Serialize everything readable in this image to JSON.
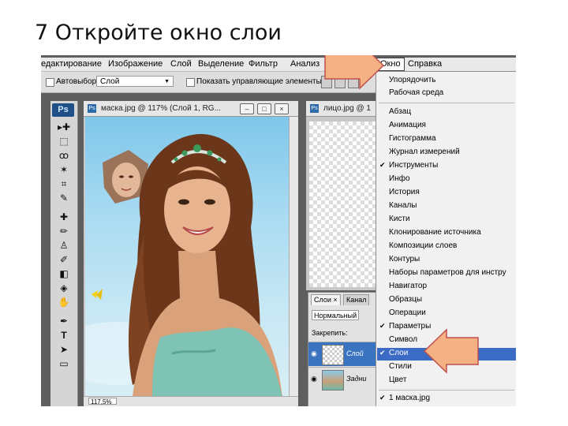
{
  "slide": {
    "title": "7 Откройте окно слои"
  },
  "menubar": {
    "items": [
      "едактирование",
      "Изображение",
      "Слой",
      "Выделение",
      "Фильтр",
      "Анализ"
    ],
    "active": "Окно",
    "last": "Справка"
  },
  "options": {
    "auto_select": "Автовыбор:",
    "layer_select": "Слой",
    "show_controls": "Показать управляющие элементы"
  },
  "toolbox": {
    "logo": "Ps",
    "tools": [
      "move-tool",
      "marquee-tool",
      "lasso-tool",
      "magic-wand-tool",
      "crop-tool",
      "eyedropper-tool",
      "spot-heal-tool",
      "brush-tool",
      "stamp-tool",
      "history-brush-tool",
      "eraser-tool",
      "paint-bucket-tool",
      "dodge-tool",
      "pen-tool",
      "type-tool",
      "path-select-tool",
      "shape-tool"
    ],
    "glyphs": [
      "▸✚",
      "⬚",
      "ꝏ",
      "✶",
      "⌗",
      "✎",
      "✚",
      "✏",
      "♙",
      "✐",
      "◧",
      "◈",
      "✋",
      "✒",
      "T",
      "➤",
      "▭"
    ]
  },
  "doc1": {
    "title": "маска.jpg @ 117% (Слой 1, RG...",
    "icon": "Ps",
    "zoom": "117,5%"
  },
  "doc2": {
    "title": "лицо.jpg @ 1",
    "icon": "Ps"
  },
  "layers_panel": {
    "tab_layers": "Слои ×",
    "tab_channels": "Канал",
    "mode": "Нормальный",
    "lock": "Закрепить:",
    "rows": [
      {
        "name": "Слой",
        "selected": true
      },
      {
        "name": "Задни",
        "selected": false
      }
    ]
  },
  "window_menu": {
    "items": [
      {
        "label": "Упорядочить",
        "checked": false
      },
      {
        "label": "Рабочая среда",
        "checked": false
      },
      {
        "label": "Абзац",
        "checked": false
      },
      {
        "label": "Анимация",
        "checked": false
      },
      {
        "label": "Гистограмма",
        "checked": false
      },
      {
        "label": "Журнал измерений",
        "checked": false
      },
      {
        "label": "Инструменты",
        "checked": true
      },
      {
        "label": "Инфо",
        "checked": false
      },
      {
        "label": "История",
        "checked": false
      },
      {
        "label": "Каналы",
        "checked": false
      },
      {
        "label": "Кисти",
        "checked": false
      },
      {
        "label": "Клонирование источника",
        "checked": false
      },
      {
        "label": "Композиции слоев",
        "checked": false
      },
      {
        "label": "Контуры",
        "checked": false
      },
      {
        "label": "Наборы параметров для инстру",
        "checked": false
      },
      {
        "label": "Навигатор",
        "checked": false
      },
      {
        "label": "Образцы",
        "checked": false
      },
      {
        "label": "Операции",
        "checked": false
      },
      {
        "label": "Параметры",
        "checked": true
      },
      {
        "label": "Символ",
        "checked": false
      },
      {
        "label": "Слои",
        "checked": true,
        "highlighted": true
      },
      {
        "label": "Стили",
        "checked": false
      },
      {
        "label": "Цвет",
        "checked": false
      },
      {
        "label": "1 маска.jpg",
        "checked": true
      }
    ]
  },
  "colors": {
    "highlight": "#3b6bc4",
    "arrow_fill": "#f4b183",
    "arrow_stroke": "#c0504d"
  }
}
